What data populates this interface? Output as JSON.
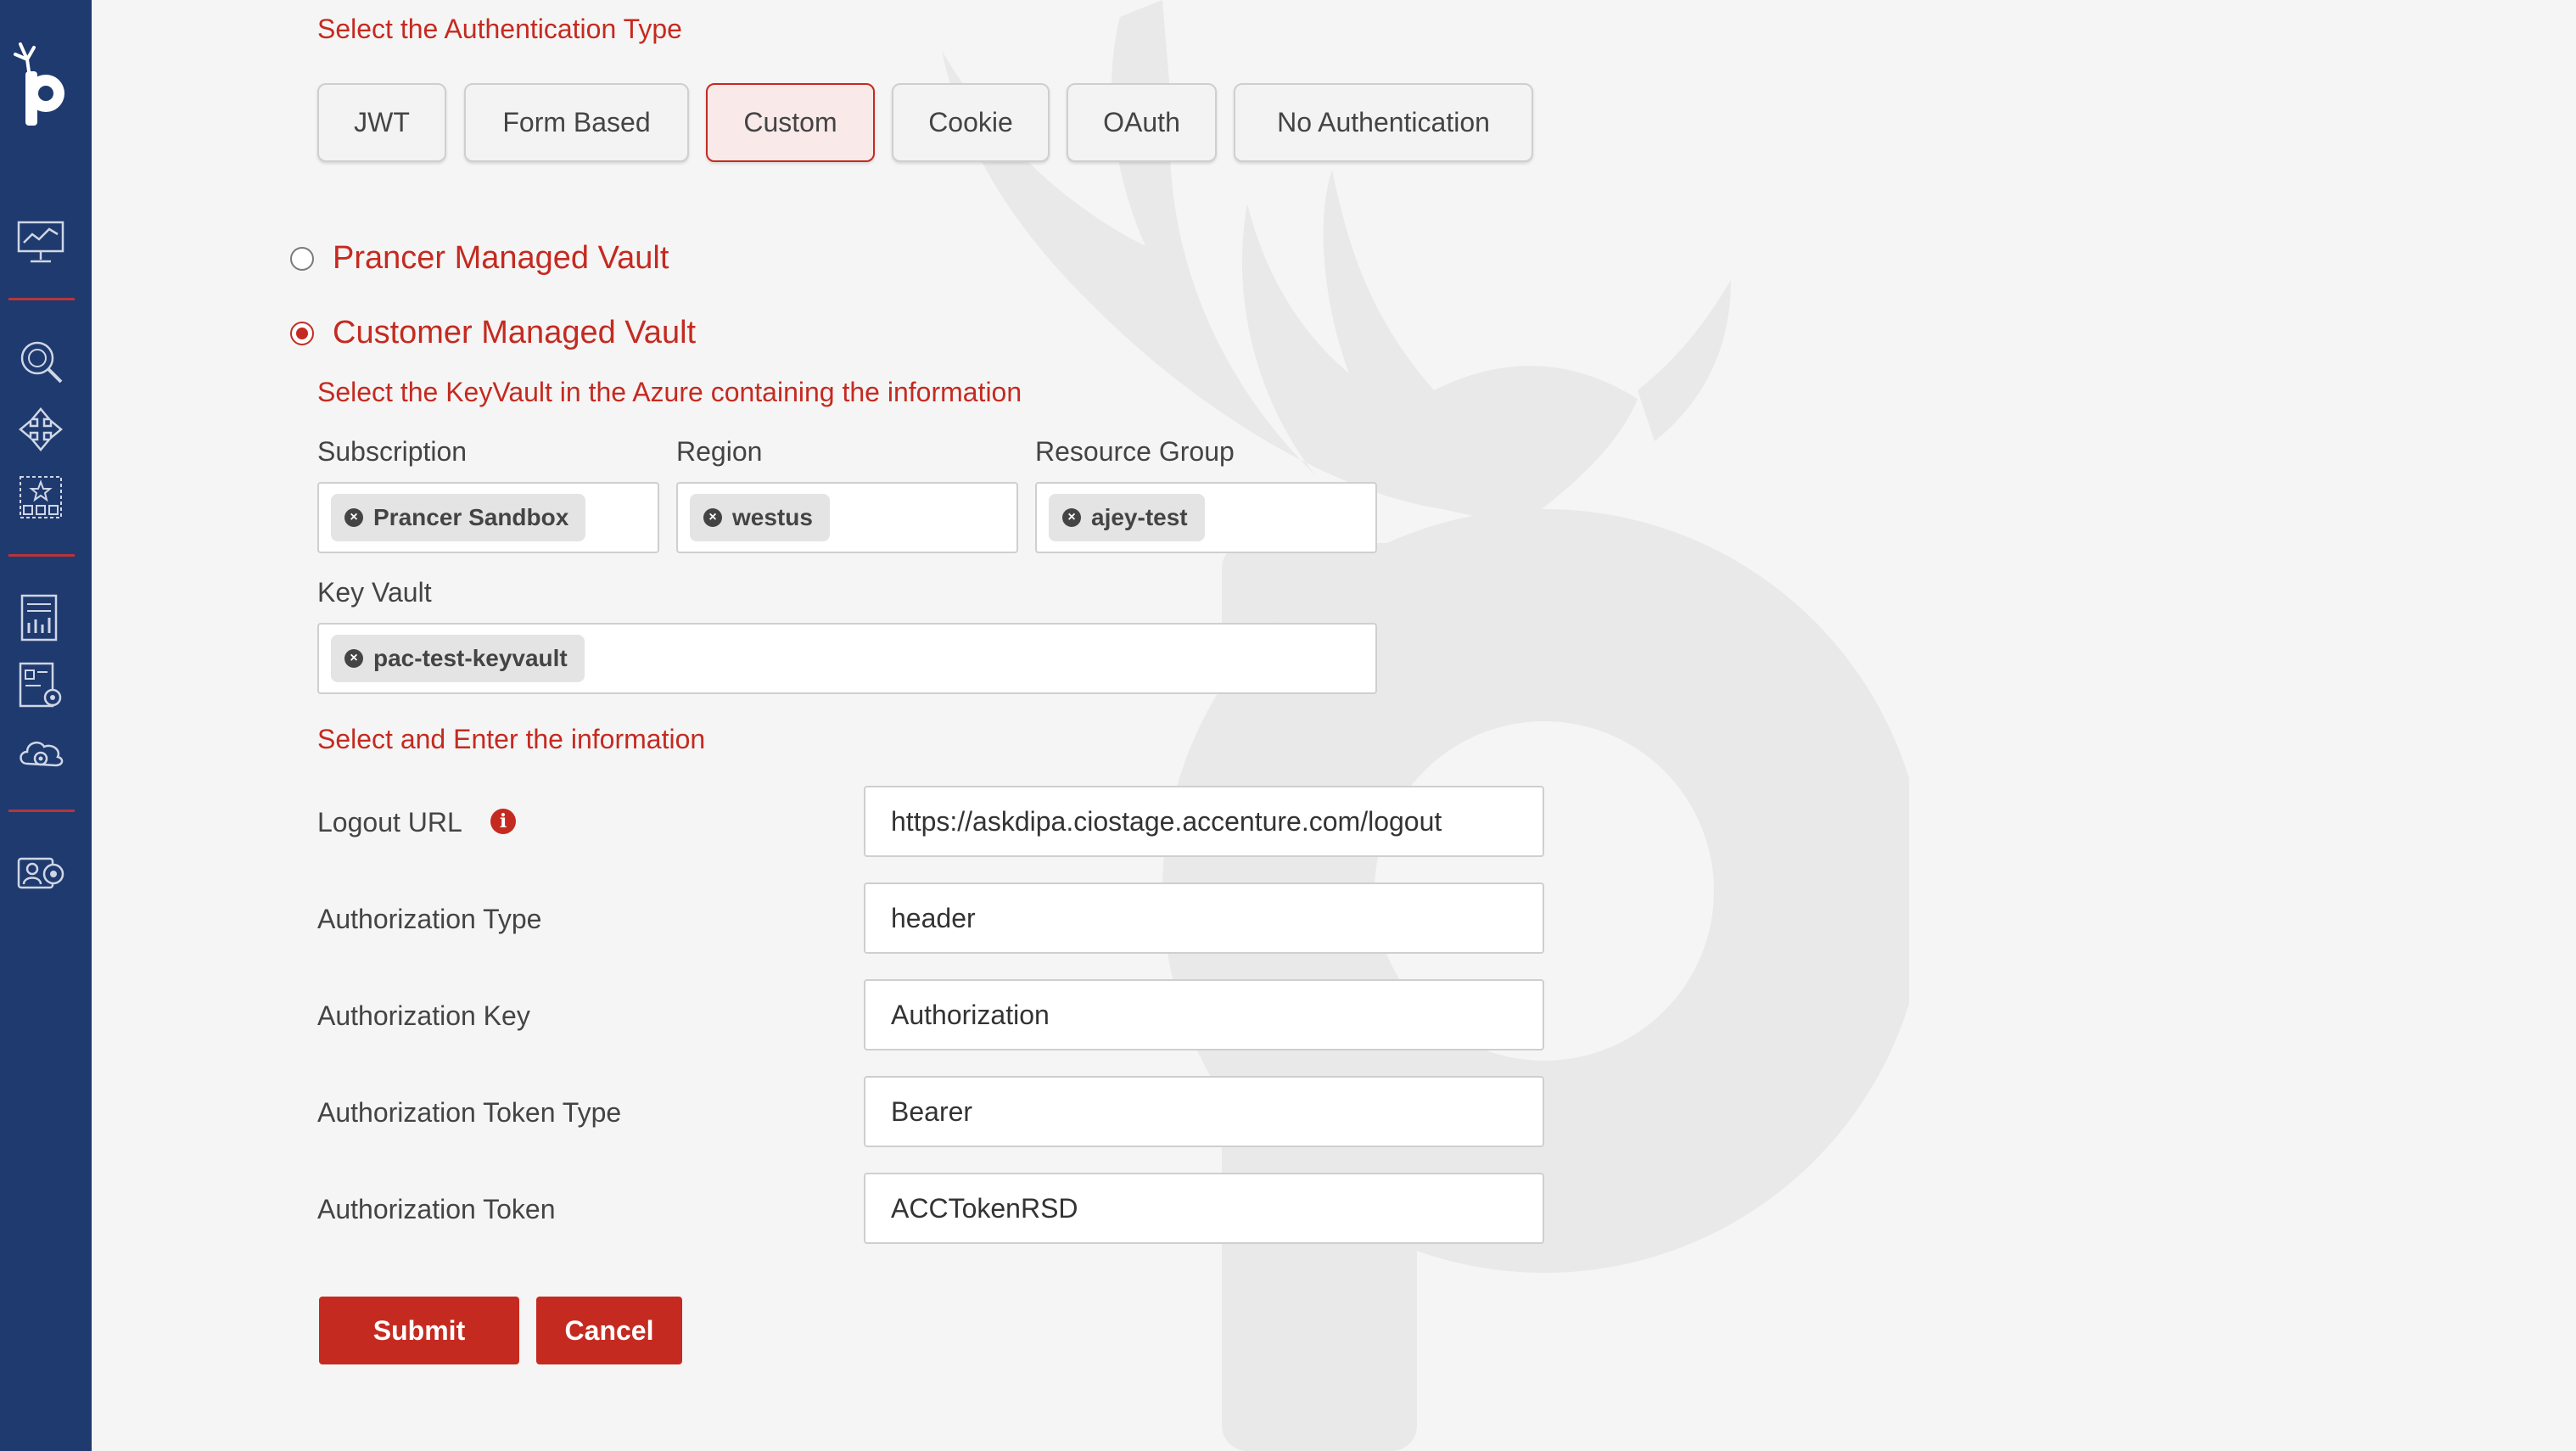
{
  "auth_type": {
    "title": "Select the Authentication Type",
    "options": [
      "JWT",
      "Form Based",
      "Custom",
      "Cookie",
      "OAuth",
      "No Authentication"
    ],
    "selected": "Custom"
  },
  "vault": {
    "prancer_label": "Prancer Managed Vault",
    "customer_label": "Customer Managed Vault",
    "selected": "Customer Managed Vault"
  },
  "keyvault": {
    "title": "Select the KeyVault in the Azure containing the information",
    "subscription_label": "Subscription",
    "subscription_value": "Prancer Sandbox",
    "region_label": "Region",
    "region_value": "westus",
    "resource_group_label": "Resource Group",
    "resource_group_value": "ajey-test",
    "key_vault_label": "Key Vault",
    "key_vault_value": "pac-test-keyvault"
  },
  "info": {
    "title": "Select and Enter the information",
    "fields": [
      {
        "label": "Logout URL",
        "value": "https://askdipa.ciostage.accenture.com/logout"
      },
      {
        "label": "Authorization Type",
        "value": "header"
      },
      {
        "label": "Authorization Key",
        "value": "Authorization"
      },
      {
        "label": "Authorization Token Type",
        "value": "Bearer"
      },
      {
        "label": "Authorization Token",
        "value": "ACCTokenRSD"
      }
    ]
  },
  "actions": {
    "submit": "Submit",
    "cancel": "Cancel"
  },
  "colors": {
    "sidebar": "#1f3a6e",
    "accent": "#c52a20",
    "background": "#f5f5f5"
  }
}
